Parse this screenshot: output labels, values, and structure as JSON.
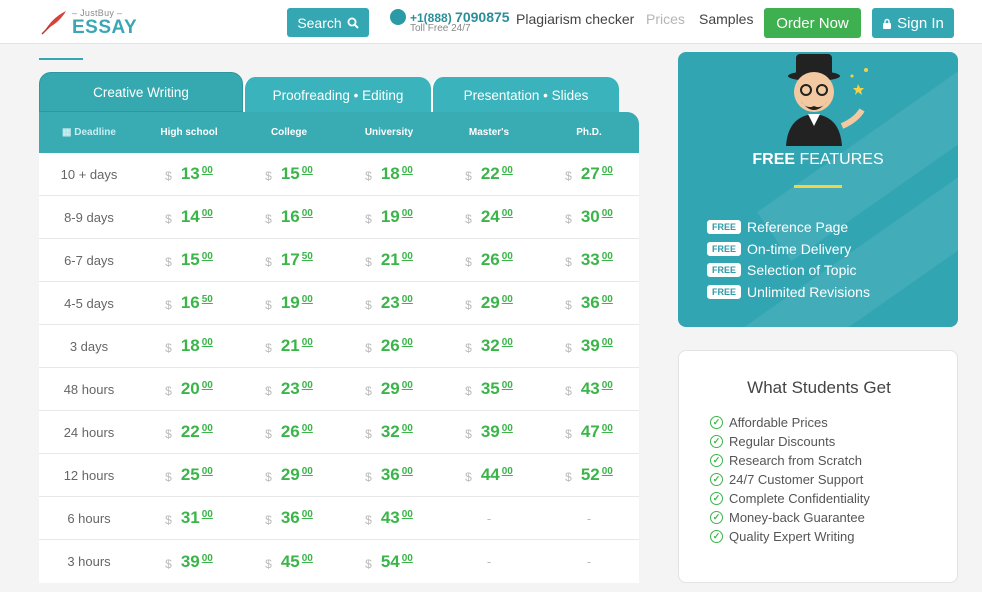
{
  "header": {
    "logo_small": "– JustBuy –",
    "logo_big": "ESSAY",
    "search_label": "Search",
    "phone_prefix": "+1(888)",
    "phone_number": "7090875",
    "phone_sub": "Toll Free 24/7",
    "nav": [
      "Plagiarism checker",
      "Prices",
      "Samples"
    ],
    "order_label": "Order Now",
    "signin_label": "Sign In"
  },
  "tabs": [
    "Creative Writing",
    "Proofreading • Editing",
    "Presentation • Slides"
  ],
  "table": {
    "columns": [
      "Deadline",
      "High school",
      "College",
      "University",
      "Master's",
      "Ph.D."
    ],
    "currency": "$",
    "rows": [
      {
        "deadline": "10 + days",
        "prices": [
          [
            "13",
            "00"
          ],
          [
            "15",
            "00"
          ],
          [
            "18",
            "00"
          ],
          [
            "22",
            "00"
          ],
          [
            "27",
            "00"
          ]
        ]
      },
      {
        "deadline": "8-9 days",
        "prices": [
          [
            "14",
            "00"
          ],
          [
            "16",
            "00"
          ],
          [
            "19",
            "00"
          ],
          [
            "24",
            "00"
          ],
          [
            "30",
            "00"
          ]
        ]
      },
      {
        "deadline": "6-7 days",
        "prices": [
          [
            "15",
            "00"
          ],
          [
            "17",
            "50"
          ],
          [
            "21",
            "00"
          ],
          [
            "26",
            "00"
          ],
          [
            "33",
            "00"
          ]
        ]
      },
      {
        "deadline": "4-5 days",
        "prices": [
          [
            "16",
            "50"
          ],
          [
            "19",
            "00"
          ],
          [
            "23",
            "00"
          ],
          [
            "29",
            "00"
          ],
          [
            "36",
            "00"
          ]
        ]
      },
      {
        "deadline": "3 days",
        "prices": [
          [
            "18",
            "00"
          ],
          [
            "21",
            "00"
          ],
          [
            "26",
            "00"
          ],
          [
            "32",
            "00"
          ],
          [
            "39",
            "00"
          ]
        ]
      },
      {
        "deadline": "48 hours",
        "prices": [
          [
            "20",
            "00"
          ],
          [
            "23",
            "00"
          ],
          [
            "29",
            "00"
          ],
          [
            "35",
            "00"
          ],
          [
            "43",
            "00"
          ]
        ]
      },
      {
        "deadline": "24 hours",
        "prices": [
          [
            "22",
            "00"
          ],
          [
            "26",
            "00"
          ],
          [
            "32",
            "00"
          ],
          [
            "39",
            "00"
          ],
          [
            "47",
            "00"
          ]
        ]
      },
      {
        "deadline": "12 hours",
        "prices": [
          [
            "25",
            "00"
          ],
          [
            "29",
            "00"
          ],
          [
            "36",
            "00"
          ],
          [
            "44",
            "00"
          ],
          [
            "52",
            "00"
          ]
        ]
      },
      {
        "deadline": "6 hours",
        "prices": [
          [
            "31",
            "00"
          ],
          [
            "36",
            "00"
          ],
          [
            "43",
            "00"
          ],
          null,
          null
        ]
      },
      {
        "deadline": "3 hours",
        "prices": [
          [
            "39",
            "00"
          ],
          [
            "45",
            "00"
          ],
          [
            "54",
            "00"
          ],
          null,
          null
        ]
      }
    ],
    "empty_mark": "-"
  },
  "free_features": {
    "title_bold": "FREE",
    "title_rest": " FEATURES",
    "badge": "FREE",
    "items": [
      "Reference Page",
      "On-time Delivery",
      "Selection of Topic",
      "Unlimited Revisions"
    ]
  },
  "students": {
    "title": "What Students Get",
    "items": [
      "Affordable Prices",
      "Regular Discounts",
      "Research from Scratch",
      "24/7 Customer Support",
      "Complete Confidentiality",
      "Money-back Guarantee",
      "Quality Expert Writing"
    ]
  },
  "colors": {
    "teal": "#34a7b2",
    "green": "#3fb050",
    "accent_yellow": "#f3d34a"
  }
}
